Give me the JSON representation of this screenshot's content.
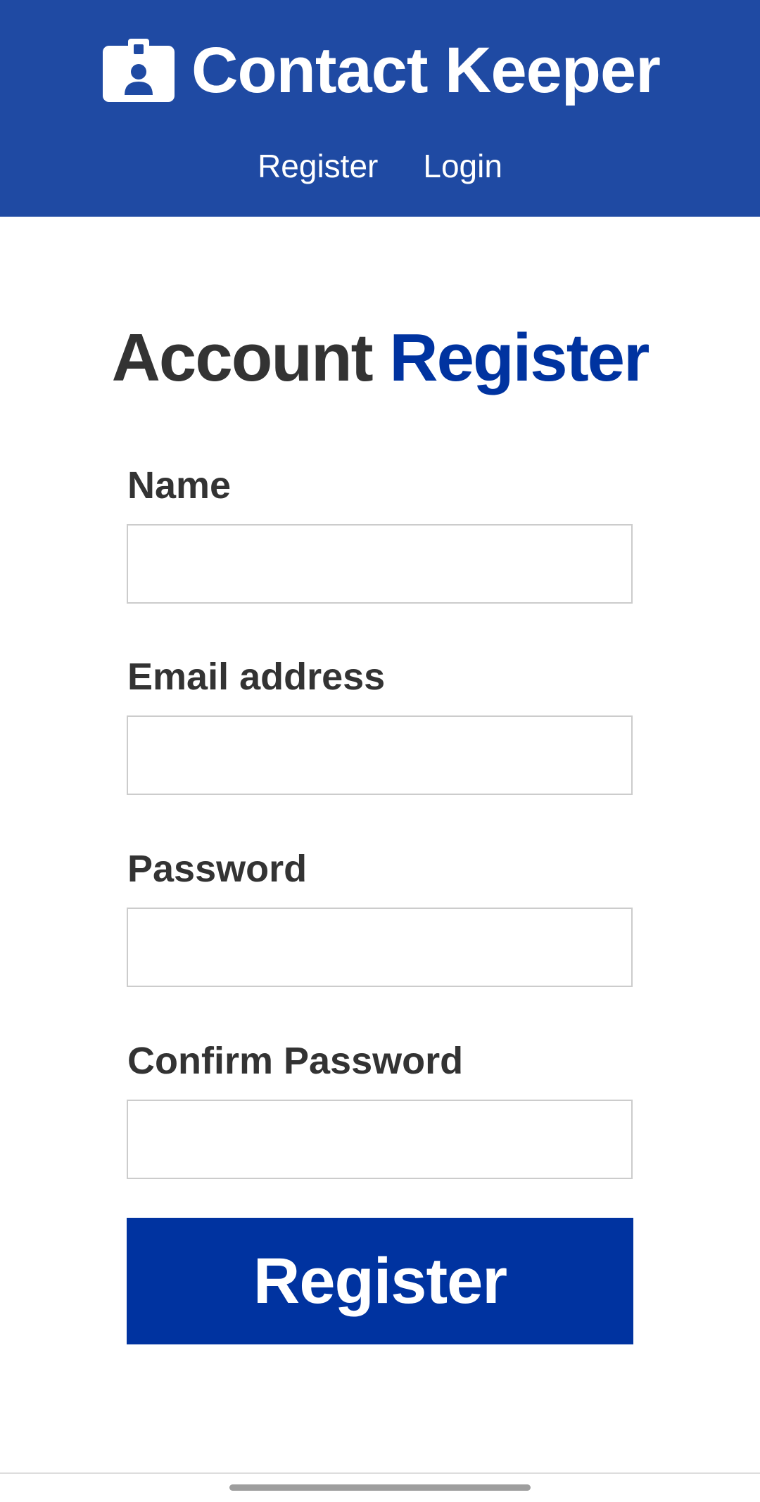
{
  "navbar": {
    "brand_icon": "id-badge-icon",
    "title": "Contact Keeper",
    "links": [
      {
        "label": "Register"
      },
      {
        "label": "Login"
      }
    ],
    "background_color": "#1f4aa3"
  },
  "page": {
    "heading_prefix": "Account",
    "heading_accent": "Register",
    "accent_color": "#0033a0"
  },
  "form": {
    "fields": [
      {
        "label": "Name",
        "value": "",
        "placeholder": "",
        "type": "text"
      },
      {
        "label": "Email address",
        "value": "",
        "placeholder": "",
        "type": "email"
      },
      {
        "label": "Password",
        "value": "",
        "placeholder": "",
        "type": "password"
      },
      {
        "label": "Confirm Password",
        "value": "",
        "placeholder": "",
        "type": "password"
      }
    ],
    "submit_label": "Register"
  }
}
